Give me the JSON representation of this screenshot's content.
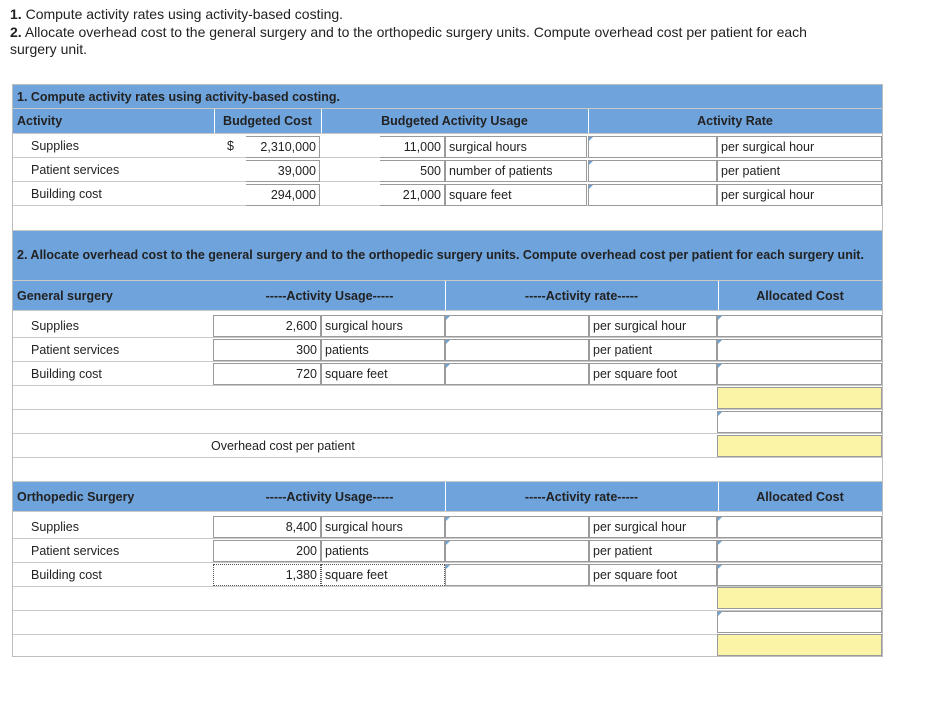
{
  "requirements": {
    "req1_num": "1.",
    "req1_text": "Compute activity rates using activity-based costing.",
    "req2_num": "2.",
    "req2_text_line1": "Allocate overhead cost to the general surgery and to the orthopedic surgery units. Compute overhead cost per patient for each",
    "req2_text_line2": "surgery unit."
  },
  "part1": {
    "title": "1. Compute activity rates using activity-based costing.",
    "headers": {
      "activity": "Activity",
      "budgeted_cost": "Budgeted Cost",
      "budgeted_usage": "Budgeted Activity Usage",
      "activity_rate": "Activity Rate"
    },
    "rows": [
      {
        "name": "Supplies",
        "currency": "$",
        "cost": "2,310,000",
        "usage": "11,000",
        "usage_unit": "surgical hours",
        "rate": "",
        "rate_unit": "per surgical hour"
      },
      {
        "name": "Patient services",
        "currency": "",
        "cost": "39,000",
        "usage": "500",
        "usage_unit": "number of patients",
        "rate": "",
        "rate_unit": "per patient"
      },
      {
        "name": "Building cost",
        "currency": "",
        "cost": "294,000",
        "usage": "21,000",
        "usage_unit": "square feet",
        "rate": "",
        "rate_unit": "per surgical hour"
      }
    ]
  },
  "part2": {
    "title": "2. Allocate overhead cost to the general surgery and to the orthopedic surgery units. Compute overhead cost per patient for each surgery unit.",
    "general": {
      "label": "General surgery",
      "usage_header": "-----Activity Usage-----",
      "rate_header": "-----Activity rate-----",
      "alloc_header": "Allocated Cost",
      "rows": [
        {
          "name": "Supplies",
          "usage": "2,600",
          "usage_unit": "surgical hours",
          "rate": "",
          "rate_unit": "per surgical hour",
          "alloc": ""
        },
        {
          "name": "Patient services",
          "usage": "300",
          "usage_unit": "patients",
          "rate": "",
          "rate_unit": "per patient",
          "alloc": ""
        },
        {
          "name": "Building cost",
          "usage": "720",
          "usage_unit": "square feet",
          "rate": "",
          "rate_unit": "per square foot",
          "alloc": ""
        }
      ],
      "total_alloc": "",
      "patients": "",
      "overhead_label": "Overhead cost per patient",
      "overhead_value": ""
    },
    "ortho": {
      "label": "Orthopedic Surgery",
      "usage_header": "-----Activity Usage-----",
      "rate_header": "-----Activity rate-----",
      "alloc_header": "Allocated Cost",
      "rows": [
        {
          "name": "Supplies",
          "usage": "8,400",
          "usage_unit": "surgical hours",
          "rate": "",
          "rate_unit": "per surgical hour",
          "alloc": ""
        },
        {
          "name": "Patient services",
          "usage": "200",
          "usage_unit": "patients",
          "rate": "",
          "rate_unit": "per patient",
          "alloc": ""
        },
        {
          "name": "Building cost",
          "usage": "1,380",
          "usage_unit": "square feet",
          "rate": "",
          "rate_unit": "per square foot",
          "alloc": ""
        }
      ],
      "total_alloc": "",
      "patients": "",
      "overhead_value": ""
    }
  },
  "colors": {
    "header_blue": "#6fa3dc",
    "answer_yellow": "#fbf3a6",
    "border_gray": "#9a9a9a"
  }
}
